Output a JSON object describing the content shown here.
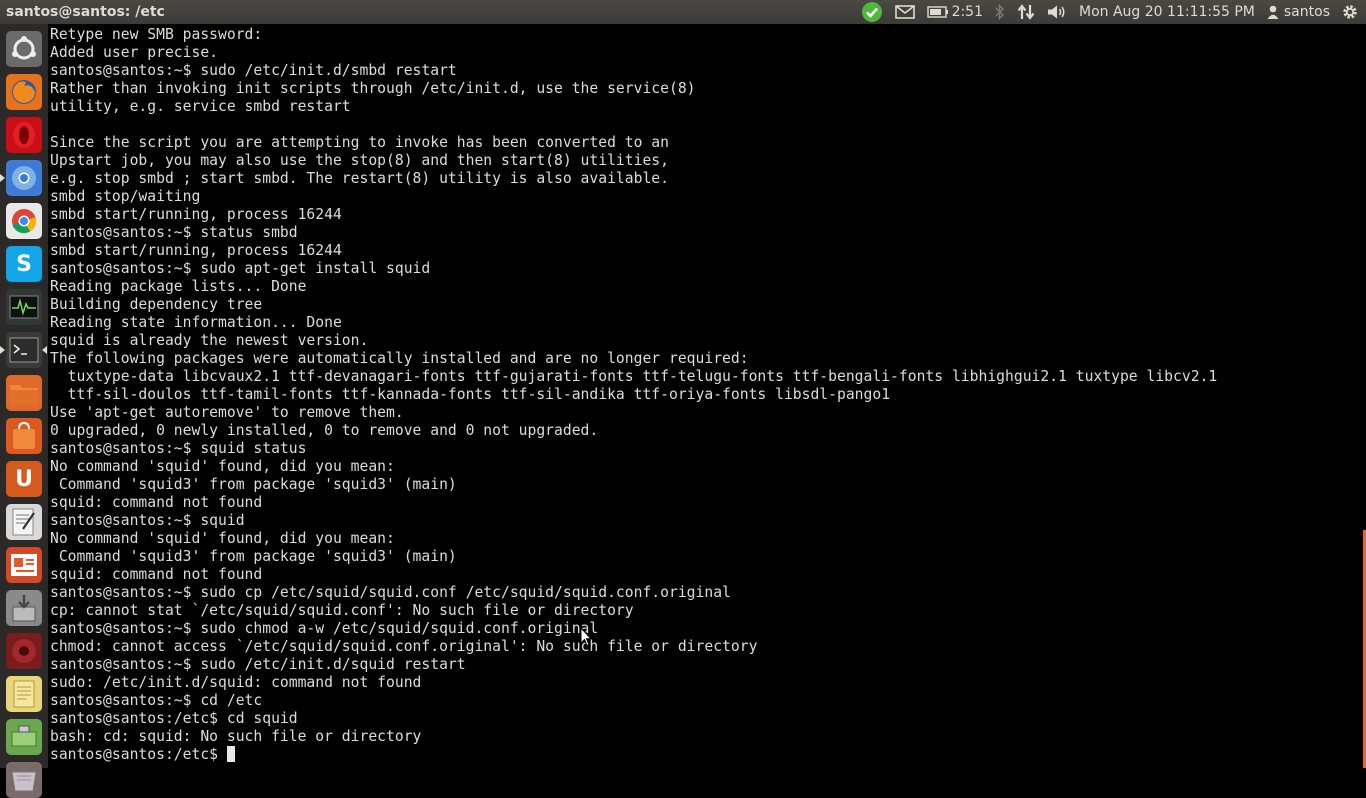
{
  "window_title": "santos@santos: /etc",
  "panel": {
    "battery_time": "2:51",
    "clock": "Mon Aug 20 11:11:55 PM",
    "user": "santos",
    "icons": [
      "update-check-icon",
      "mail-icon",
      "battery-icon",
      "bluetooth-icon",
      "network-icon",
      "volume-icon",
      "user-icon",
      "gear-icon"
    ]
  },
  "launcher": {
    "items": [
      {
        "name": "dash-home",
        "icon": "ubuntu-logo-icon",
        "color": "#6b6b6b"
      },
      {
        "name": "firefox",
        "icon": "firefox-icon",
        "color": "#e6711c"
      },
      {
        "name": "opera",
        "icon": "opera-icon",
        "color": "#cc0f16"
      },
      {
        "name": "chromium",
        "icon": "chromium-icon",
        "color": "#3d7bd6"
      },
      {
        "name": "chrome",
        "icon": "chrome-icon",
        "color": "#e9e9e9"
      },
      {
        "name": "skype",
        "icon": "skype-icon",
        "color": "#12a5e7"
      },
      {
        "name": "system-monitor",
        "icon": "system-monitor-icon",
        "color": "#2f3a36"
      },
      {
        "name": "terminal",
        "icon": "terminal-icon",
        "color": "#3a3a3a"
      },
      {
        "name": "files",
        "icon": "folder-icon",
        "color": "#e0682a"
      },
      {
        "name": "software-center",
        "icon": "shopping-bag-icon",
        "color": "#dc5a21"
      },
      {
        "name": "ubuntu-one",
        "icon": "ubuntu-one-icon",
        "color": "#d65a1d"
      },
      {
        "name": "text-editor",
        "icon": "text-editor-icon",
        "color": "#d9d9d9"
      },
      {
        "name": "presentation",
        "icon": "impress-icon",
        "color": "#d44a26"
      },
      {
        "name": "installer",
        "icon": "installer-icon",
        "color": "#8a8a8a"
      },
      {
        "name": "recorder",
        "icon": "recorder-icon",
        "color": "#7a1c1c"
      },
      {
        "name": "notes",
        "icon": "notes-icon",
        "color": "#e9d57a"
      },
      {
        "name": "removable-drive",
        "icon": "usb-drive-icon",
        "color": "#6aa84f"
      },
      {
        "name": "trash",
        "icon": "trash-icon",
        "color": "#7a6a6a"
      }
    ]
  },
  "terminal": {
    "prompt": "santos@santos:/etc$ ",
    "lines": [
      "Retype new SMB password:",
      "Added user precise.",
      "santos@santos:~$ sudo /etc/init.d/smbd restart",
      "Rather than invoking init scripts through /etc/init.d, use the service(8)",
      "utility, e.g. service smbd restart",
      "",
      "Since the script you are attempting to invoke has been converted to an",
      "Upstart job, you may also use the stop(8) and then start(8) utilities,",
      "e.g. stop smbd ; start smbd. The restart(8) utility is also available.",
      "smbd stop/waiting",
      "smbd start/running, process 16244",
      "santos@santos:~$ status smbd",
      "smbd start/running, process 16244",
      "santos@santos:~$ sudo apt-get install squid",
      "Reading package lists... Done",
      "Building dependency tree",
      "Reading state information... Done",
      "squid is already the newest version.",
      "The following packages were automatically installed and are no longer required:",
      "  tuxtype-data libcvaux2.1 ttf-devanagari-fonts ttf-gujarati-fonts ttf-telugu-fonts ttf-bengali-fonts libhighgui2.1 tuxtype libcv2.1",
      "  ttf-sil-doulos ttf-tamil-fonts ttf-kannada-fonts ttf-sil-andika ttf-oriya-fonts libsdl-pango1",
      "Use 'apt-get autoremove' to remove them.",
      "0 upgraded, 0 newly installed, 0 to remove and 0 not upgraded.",
      "santos@santos:~$ squid status",
      "No command 'squid' found, did you mean:",
      " Command 'squid3' from package 'squid3' (main)",
      "squid: command not found",
      "santos@santos:~$ squid",
      "No command 'squid' found, did you mean:",
      " Command 'squid3' from package 'squid3' (main)",
      "squid: command not found",
      "santos@santos:~$ sudo cp /etc/squid/squid.conf /etc/squid/squid.conf.original",
      "cp: cannot stat `/etc/squid/squid.conf': No such file or directory",
      "santos@santos:~$ sudo chmod a-w /etc/squid/squid.conf.original",
      "chmod: cannot access `/etc/squid/squid.conf.original': No such file or directory",
      "santos@santos:~$ sudo /etc/init.d/squid restart",
      "sudo: /etc/init.d/squid: command not found",
      "santos@santos:~$ cd /etc",
      "santos@santos:/etc$ cd squid",
      "bash: cd: squid: No such file or directory"
    ]
  }
}
